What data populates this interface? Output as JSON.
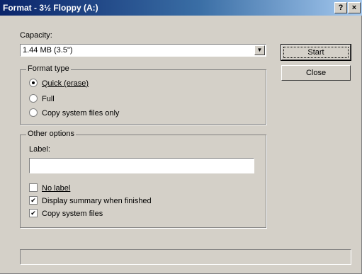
{
  "window": {
    "title": "Format - 3½ Floppy (A:)",
    "help_button": "?",
    "close_button": "×"
  },
  "capacity": {
    "label": "Capacity:",
    "selected": "1.44 MB (3.5\")"
  },
  "buttons": {
    "start": "Start",
    "close": "Close"
  },
  "format_type": {
    "legend": "Format type",
    "options": [
      {
        "label": "Quick (erase)",
        "selected": true
      },
      {
        "label": "Full",
        "selected": false
      },
      {
        "label": "Copy system files only",
        "selected": false
      }
    ]
  },
  "other_options": {
    "legend": "Other options",
    "label_field": {
      "label": "Label:",
      "value": ""
    },
    "checkboxes": [
      {
        "label": "No label",
        "checked": false
      },
      {
        "label": "Display summary when finished",
        "checked": true
      },
      {
        "label": "Copy system files",
        "checked": true
      }
    ]
  },
  "progress": {
    "value": 0
  }
}
